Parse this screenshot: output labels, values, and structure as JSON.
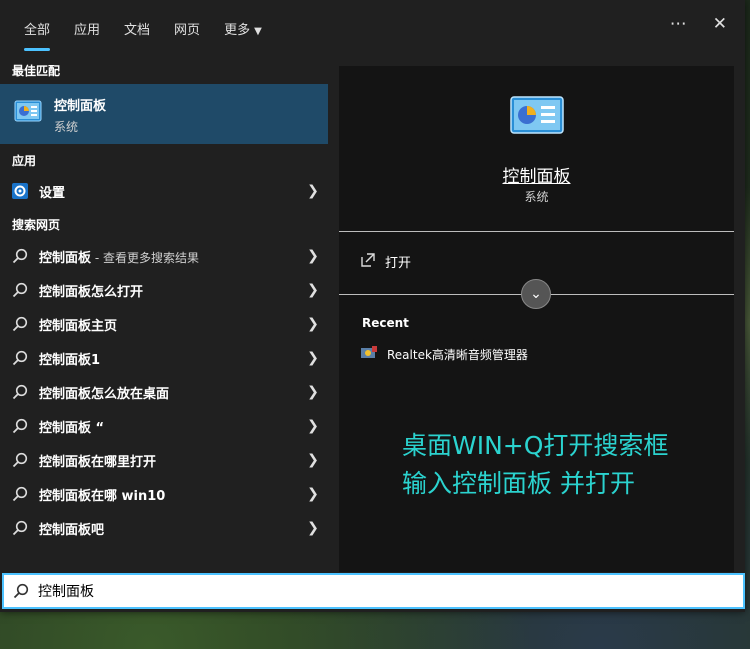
{
  "tabs": [
    {
      "label": "全部",
      "active": true
    },
    {
      "label": "应用"
    },
    {
      "label": "文档"
    },
    {
      "label": "网页"
    },
    {
      "label": "更多"
    }
  ],
  "toolbar": {
    "more_icon": "ellipsis-icon",
    "close_icon": "close-icon"
  },
  "best_match": {
    "section_title": "最佳匹配",
    "title": "控制面板",
    "subtitle": "系统"
  },
  "apps": {
    "section_title": "应用",
    "items": [
      {
        "label": "设置",
        "icon": "settings-gear-icon"
      }
    ]
  },
  "web": {
    "section_title": "搜索网页",
    "first": {
      "label": "控制面板",
      "extra": " - 查看更多搜索结果"
    },
    "items": [
      "控制面板怎么打开",
      "控制面板主页",
      "控制面板1",
      "控制面板怎么放在桌面",
      "控制面板 “",
      "控制面板在哪里打开",
      "控制面板在哪 win10",
      "控制面板吧"
    ]
  },
  "preview": {
    "title": "控制面板",
    "subtitle": "系统",
    "open_label": "打开",
    "recent_title": "Recent",
    "recent_items": [
      "Realtek高清晰音频管理器"
    ]
  },
  "overlay": {
    "line1": "桌面WIN+Q打开搜索框",
    "line2": "输入控制面板 并打开"
  },
  "search": {
    "value": "控制面板"
  },
  "colors": {
    "accent": "#4cc2ff",
    "selected_bg": "#1f4a68",
    "overlay_text": "#2bd3cf"
  }
}
